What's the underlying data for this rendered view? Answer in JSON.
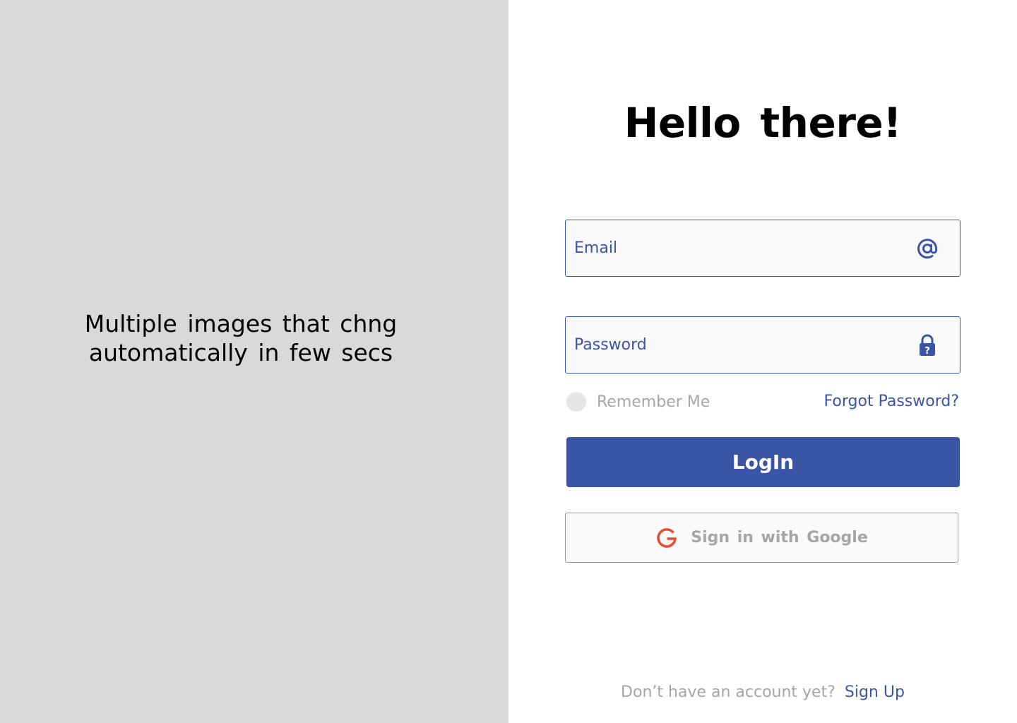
{
  "left_panel": {
    "caption_line1": "Multiple images that chng",
    "caption_line2": "automatically in few secs",
    "background": "#d9d9d9"
  },
  "form": {
    "title": "Hello there!",
    "email": {
      "placeholder": "Email",
      "value": "",
      "icon": "at-sign-icon"
    },
    "password": {
      "placeholder": "Password",
      "value": "",
      "icon": "lock-question-icon"
    },
    "remember_label": "Remember Me",
    "remember_checked": false,
    "forgot_label": "Forgot Password?",
    "login_label": "LogIn",
    "google_label": "Sign in with Google",
    "google_icon": "google-g-icon",
    "no_account_text": "Don’t have an account yet?",
    "signup_label": "Sign Up"
  },
  "colors": {
    "accent": "#3a54a6",
    "muted_text": "#a6a6a6",
    "google_red": "#e94b2f"
  }
}
